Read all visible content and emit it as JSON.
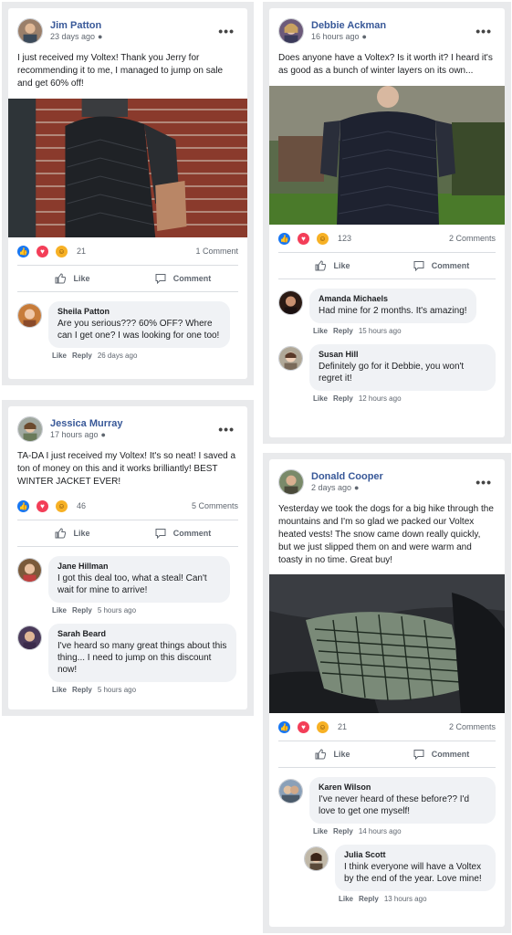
{
  "posts": [
    {
      "author": "Jim Patton",
      "time": "23 days ago",
      "globe": "●",
      "text": "I just received my Voltex! Thank you Jerry for recommending it to me, I managed to jump on sale and get 60% off!",
      "reactions": "21",
      "comments_label": "1 Comment",
      "like_label": "Like",
      "comment_label": "Comment",
      "comments": [
        {
          "name": "Sheila Patton",
          "text": "Are you serious??? 60% OFF? Where can I get one? I was looking for one too!",
          "like": "Like",
          "reply": "Reply",
          "time": "26 days ago"
        }
      ]
    },
    {
      "author": "Debbie Ackman",
      "time": "16 hours ago",
      "globe": "●",
      "text": "Does anyone have a Voltex? Is it worth it? I heard it's as good as a bunch of winter layers on its own...",
      "reactions": "123",
      "comments_label": "2 Comments",
      "like_label": "Like",
      "comment_label": "Comment",
      "comments": [
        {
          "name": "Amanda Michaels",
          "text": "Had mine for 2 months. It's amazing!",
          "like": "Like",
          "reply": "Reply",
          "time": "15 hours ago"
        },
        {
          "name": "Susan Hill",
          "text": "Definitely go for it Debbie, you won't regret it!",
          "like": "Like",
          "reply": "Reply",
          "time": "12 hours ago"
        }
      ]
    },
    {
      "author": "Jessica Murray",
      "time": "17 hours ago",
      "globe": "●",
      "text": "TA-DA I just received my Voltex! It's so neat! I saved a ton of money on this and it works brilliantly! BEST WINTER JACKET EVER!",
      "reactions": "46",
      "comments_label": "5 Comments",
      "like_label": "Like",
      "comment_label": "Comment",
      "comments": [
        {
          "name": "Jane Hillman",
          "text": "I got this deal too, what a steal! Can't wait for mine to arrive!",
          "like": "Like",
          "reply": "Reply",
          "time": "5 hours ago"
        },
        {
          "name": "Sarah Beard",
          "text": "I've heard so many great things about this thing... I need to jump on this discount now!",
          "like": "Like",
          "reply": "Reply",
          "time": "5 hours ago"
        }
      ]
    },
    {
      "author": "Donald Cooper",
      "time": "2 days ago",
      "globe": "●",
      "text": "Yesterday we took the dogs for a big hike through the mountains and I'm so glad we packed our Voltex heated vests! The snow came down really quickly, but we just slipped them on and were warm and toasty in no time. Great buy!",
      "reactions": "21",
      "comments_label": "2 Comments",
      "like_label": "Like",
      "comment_label": "Comment",
      "comments": [
        {
          "name": "Karen Wilson",
          "text": "I've never heard of these before?? I'd love to get one myself!",
          "like": "Like",
          "reply": "Reply",
          "time": "14 hours ago"
        },
        {
          "name": "Julia Scott",
          "text": "I think everyone will have a Voltex by the end of the year. Love mine!",
          "like": "Like",
          "reply": "Reply",
          "time": "13 hours ago"
        }
      ]
    }
  ],
  "icons": {
    "more": "•••",
    "like_reaction": "👍",
    "love_reaction": "♥",
    "haha_reaction": "☺"
  },
  "colors": {
    "link": "#385898",
    "like": "#1877f2",
    "love": "#f33e58",
    "haha": "#f7b125"
  }
}
